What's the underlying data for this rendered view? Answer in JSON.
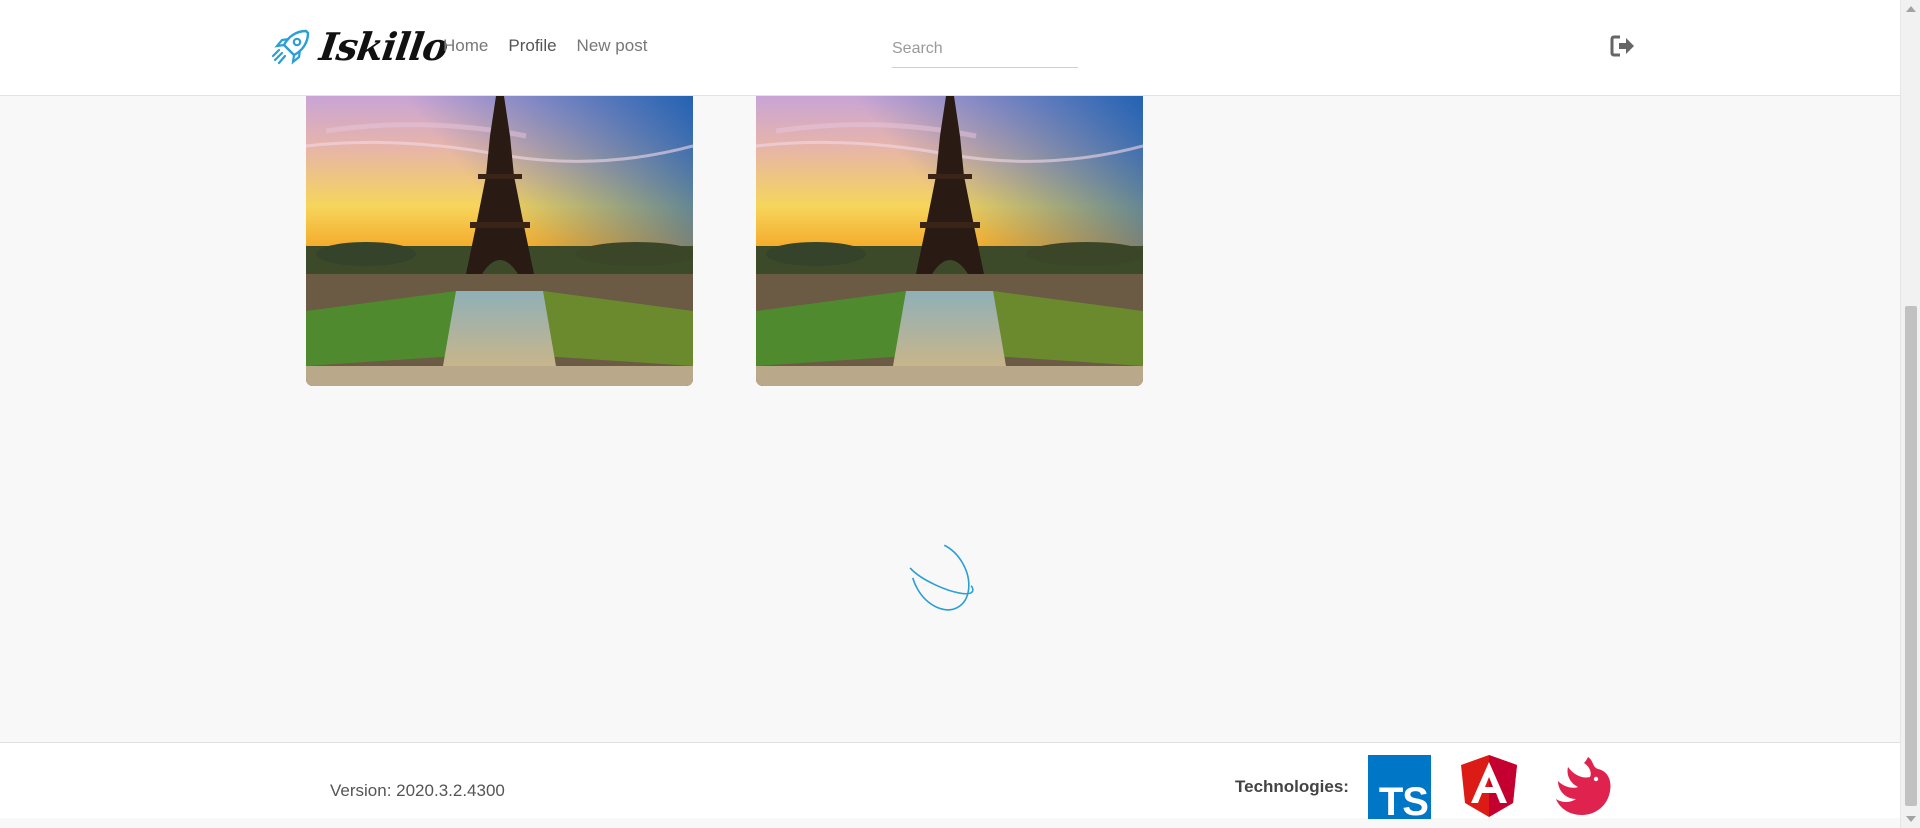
{
  "header": {
    "logo": {
      "text": "Iskillo",
      "icon": "rocket-icon"
    },
    "nav": [
      {
        "label": "Home",
        "active": false
      },
      {
        "label": "Profile",
        "active": true
      },
      {
        "label": "New post",
        "active": false
      }
    ],
    "search": {
      "placeholder": "Search",
      "value": ""
    },
    "logout_icon": "logout-icon"
  },
  "posts": [
    {
      "image": "eiffel-tower-sunset"
    },
    {
      "image": "eiffel-tower-sunset"
    }
  ],
  "loader": {
    "icon": "loading-spinner-icon"
  },
  "footer": {
    "version": "Version: 2020.3.2.4300",
    "technologies_label": "Technologies:",
    "technologies": [
      {
        "icon": "typescript-icon",
        "text": "TS",
        "color": "#0076c6"
      },
      {
        "icon": "angular-icon",
        "text": "A",
        "color": "#dd1b16"
      },
      {
        "icon": "nestjs-icon",
        "color": "#e0234e"
      }
    ]
  },
  "colors": {
    "accent": "#2a9fd6",
    "background": "#f8f8f8"
  }
}
